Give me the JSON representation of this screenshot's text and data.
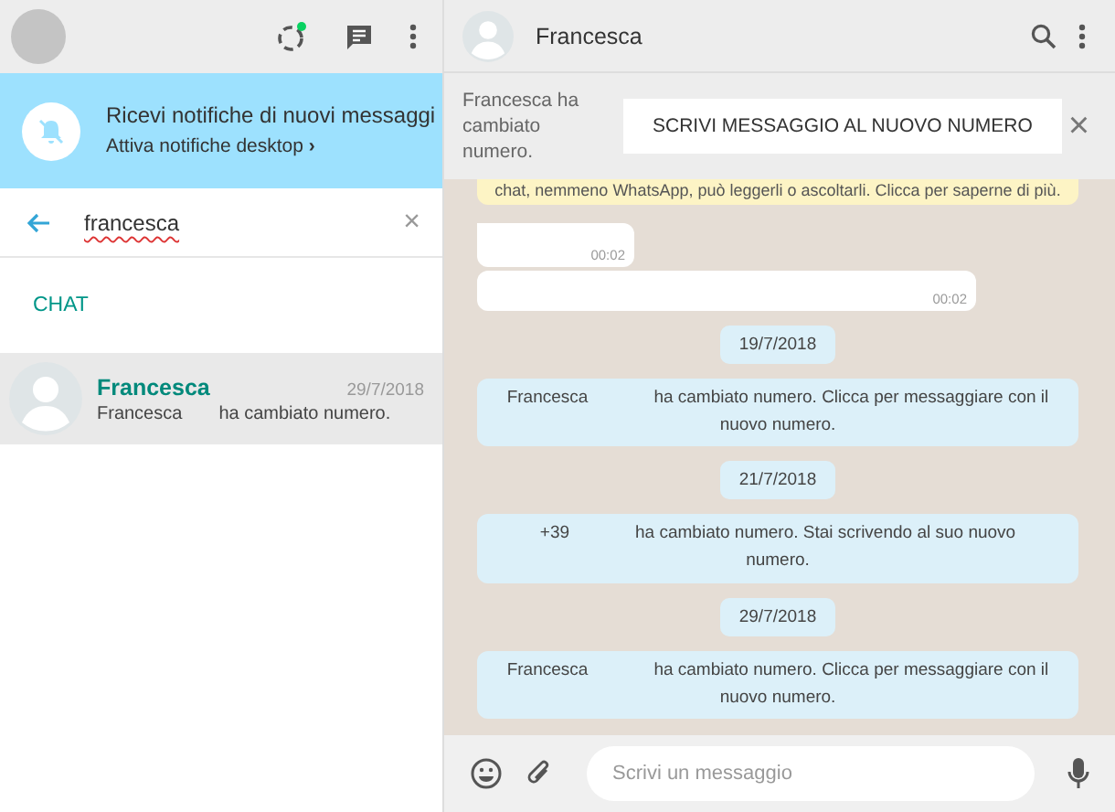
{
  "sidebar": {
    "header": {
      "has_status_dot": true
    },
    "notification": {
      "title": "Ricevi notifiche di nuovi messaggi",
      "link": "Attiva notifiche desktop",
      "link_arrow": "›"
    },
    "search": {
      "value": "francesca",
      "clear": "×"
    },
    "section_label": "CHAT",
    "chats": [
      {
        "name": "Francesca",
        "date": "29/7/2018",
        "preview_name": "Francesca",
        "preview_text": "ha cambiato numero.",
        "selected": true
      }
    ]
  },
  "chat": {
    "title": "Francesca",
    "banner": {
      "text": "Francesca ha cambiato numero.",
      "button": "SCRIVI MESSAGGIO AL NUOVO NUMERO",
      "close": "×"
    },
    "messages": [
      {
        "kind": "notice",
        "text": "chat, nemmeno WhatsApp, può leggerli o ascoltarli. Clicca per saperne di più."
      },
      {
        "kind": "bubble",
        "time": "00:02",
        "wide": false,
        "tail": true
      },
      {
        "kind": "bubble",
        "time": "00:02",
        "wide": true,
        "tail": false
      },
      {
        "kind": "date",
        "text": "19/7/2018"
      },
      {
        "kind": "system",
        "name": "Francesca",
        "text": "ha cambiato numero. Clicca per messaggiare con il nuovo numero."
      },
      {
        "kind": "date",
        "text": "21/7/2018"
      },
      {
        "kind": "system",
        "name": "+39",
        "text": "ha cambiato numero. Stai scrivendo al suo nuovo numero."
      },
      {
        "kind": "date",
        "text": "29/7/2018"
      },
      {
        "kind": "system",
        "name": "Francesca",
        "text": "ha cambiato numero. Clicca per messaggiare con il nuovo numero."
      }
    ],
    "composer": {
      "placeholder": "Scrivi un messaggio"
    }
  }
}
